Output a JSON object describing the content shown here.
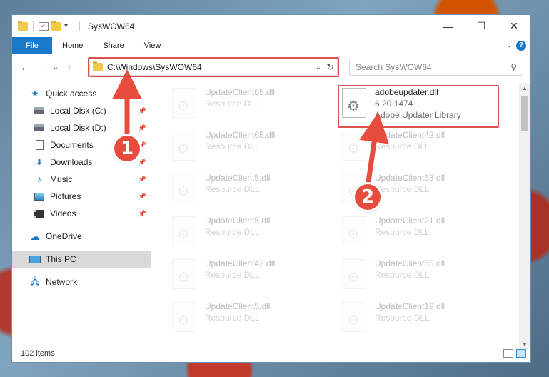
{
  "window": {
    "title": "SysWOW64",
    "controls": {
      "minimize": "—",
      "maximize": "☐",
      "close": "✕"
    }
  },
  "ribbon": {
    "tabs": [
      "File",
      "Home",
      "Share",
      "View"
    ],
    "help": "?"
  },
  "nav": {
    "back": "←",
    "forward": "→",
    "recent": "⌄",
    "up": "↑",
    "address": "C:\\Windows\\SysWOW64",
    "refresh": "↻",
    "search_placeholder": "Search SysWOW64"
  },
  "sidebar": {
    "quick_access": "Quick access",
    "pinned": [
      {
        "label": "Local Disk (C:)",
        "icon": "drive-icon"
      },
      {
        "label": "Local Disk (D:)",
        "icon": "drive-icon"
      },
      {
        "label": "Documents",
        "icon": "documents-icon"
      },
      {
        "label": "Downloads",
        "icon": "downloads-icon"
      },
      {
        "label": "Music",
        "icon": "music-icon"
      },
      {
        "label": "Pictures",
        "icon": "pictures-icon"
      },
      {
        "label": "Videos",
        "icon": "videos-icon"
      }
    ],
    "onedrive": "OneDrive",
    "this_pc": "This PC",
    "network": "Network"
  },
  "files": {
    "highlight": {
      "name": "adobeupdater.dll",
      "version": "6 20 1474",
      "description": "Adobe Updater Library"
    },
    "left_column": [
      {
        "name": "UpdateClient65.dll",
        "type": "Resource DLL"
      },
      {
        "name": "UpdateClient65.dll",
        "type": "Resource DLL"
      },
      {
        "name": "UpdateClient5.dll",
        "type": "Resource DLL"
      },
      {
        "name": "UpdateClient5.dll",
        "type": "Resource DLL"
      },
      {
        "name": "UpdateClient42.dll",
        "type": "Resource DLL"
      },
      {
        "name": "UpdateClient5.dll",
        "type": "Resource DLL"
      }
    ],
    "right_column": [
      {
        "name": "UpdateClient42.dll",
        "type": "Resource DLL"
      },
      {
        "name": "UpdateClient63.dll",
        "type": "Resource DLL"
      },
      {
        "name": "UpdateClient21.dll",
        "type": "Resource DLL"
      },
      {
        "name": "UpdateClient65.dll",
        "type": "Resource DLL"
      },
      {
        "name": "UpdateClient19.dll",
        "type": "Resource DLL"
      }
    ]
  },
  "status": {
    "item_count": "102 items"
  },
  "annotations": {
    "marker_1": "1",
    "marker_2": "2",
    "color": "#e74c3c"
  }
}
